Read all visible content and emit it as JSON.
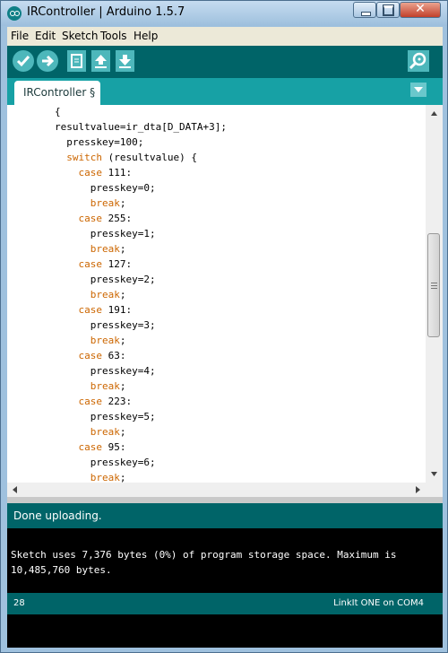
{
  "window": {
    "title": "IRController | Arduino 1.5.7"
  },
  "menu": [
    "File",
    "Edit",
    "Sketch",
    "Tools",
    "Help"
  ],
  "toolbar": {
    "verify": "verify-icon",
    "upload": "upload-icon",
    "new": "new-icon",
    "open": "open-icon",
    "save": "save-icon",
    "serial_monitor": "serial-monitor-icon"
  },
  "tab": {
    "label": "IRController §"
  },
  "code": [
    {
      "indent": "        ",
      "kw": "",
      "rest": "{"
    },
    {
      "indent": "        ",
      "kw": "",
      "rest": "resultvalue=ir_dta[D_DATA+3];"
    },
    {
      "indent": "          ",
      "kw": "",
      "rest": "presskey=100;"
    },
    {
      "indent": "          ",
      "kw": "switch",
      "rest": " (resultvalue) {"
    },
    {
      "indent": "            ",
      "kw": "case",
      "rest": " 111:"
    },
    {
      "indent": "              ",
      "kw": "",
      "rest": "presskey=0;"
    },
    {
      "indent": "              ",
      "kw": "break",
      "rest": ";"
    },
    {
      "indent": "            ",
      "kw": "case",
      "rest": " 255:"
    },
    {
      "indent": "              ",
      "kw": "",
      "rest": "presskey=1;"
    },
    {
      "indent": "              ",
      "kw": "break",
      "rest": ";"
    },
    {
      "indent": "            ",
      "kw": "case",
      "rest": " 127:"
    },
    {
      "indent": "              ",
      "kw": "",
      "rest": "presskey=2;"
    },
    {
      "indent": "              ",
      "kw": "break",
      "rest": ";"
    },
    {
      "indent": "            ",
      "kw": "case",
      "rest": " 191:"
    },
    {
      "indent": "              ",
      "kw": "",
      "rest": "presskey=3;"
    },
    {
      "indent": "              ",
      "kw": "break",
      "rest": ";"
    },
    {
      "indent": "            ",
      "kw": "case",
      "rest": " 63:"
    },
    {
      "indent": "              ",
      "kw": "",
      "rest": "presskey=4;"
    },
    {
      "indent": "              ",
      "kw": "break",
      "rest": ";"
    },
    {
      "indent": "            ",
      "kw": "case",
      "rest": " 223:"
    },
    {
      "indent": "              ",
      "kw": "",
      "rest": "presskey=5;"
    },
    {
      "indent": "              ",
      "kw": "break",
      "rest": ";"
    },
    {
      "indent": "            ",
      "kw": "case",
      "rest": " 95:"
    },
    {
      "indent": "              ",
      "kw": "",
      "rest": "presskey=6;"
    },
    {
      "indent": "              ",
      "kw": "break",
      "rest": ";"
    }
  ],
  "status": {
    "message": "Done uploading."
  },
  "console": {
    "lines": [
      "Sketch uses 7,376 bytes (0%) of program storage space. Maximum is",
      "10,485,760 bytes."
    ]
  },
  "footer": {
    "line_number": "28",
    "board": "LinkIt ONE on COM4"
  },
  "colors": {
    "teal_dark": "#006468",
    "teal_tab": "#17a1a5",
    "keyword": "#cc6600"
  }
}
